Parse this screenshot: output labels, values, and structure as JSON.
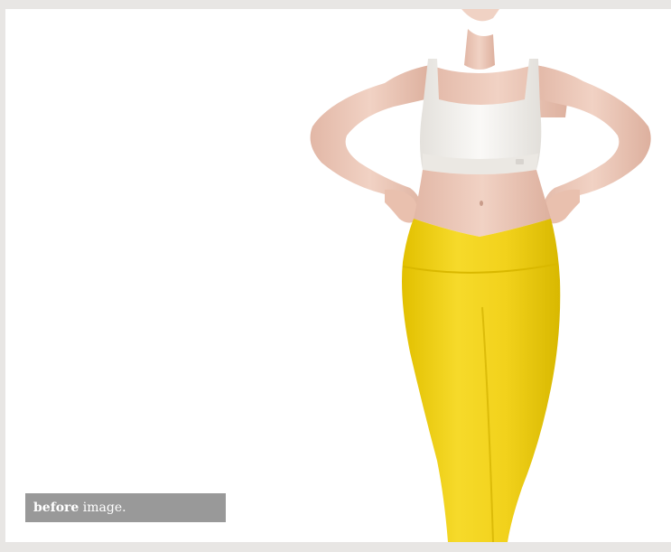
{
  "caption": {
    "bold_text": "before",
    "rest_text": " image."
  },
  "colors": {
    "background_border": "#e8e6e4",
    "canvas": "#ffffff",
    "caption_bg": "#999999",
    "leggings": "#f2d21c",
    "top": "#f4f2ef",
    "skin": "#eac4b4"
  }
}
